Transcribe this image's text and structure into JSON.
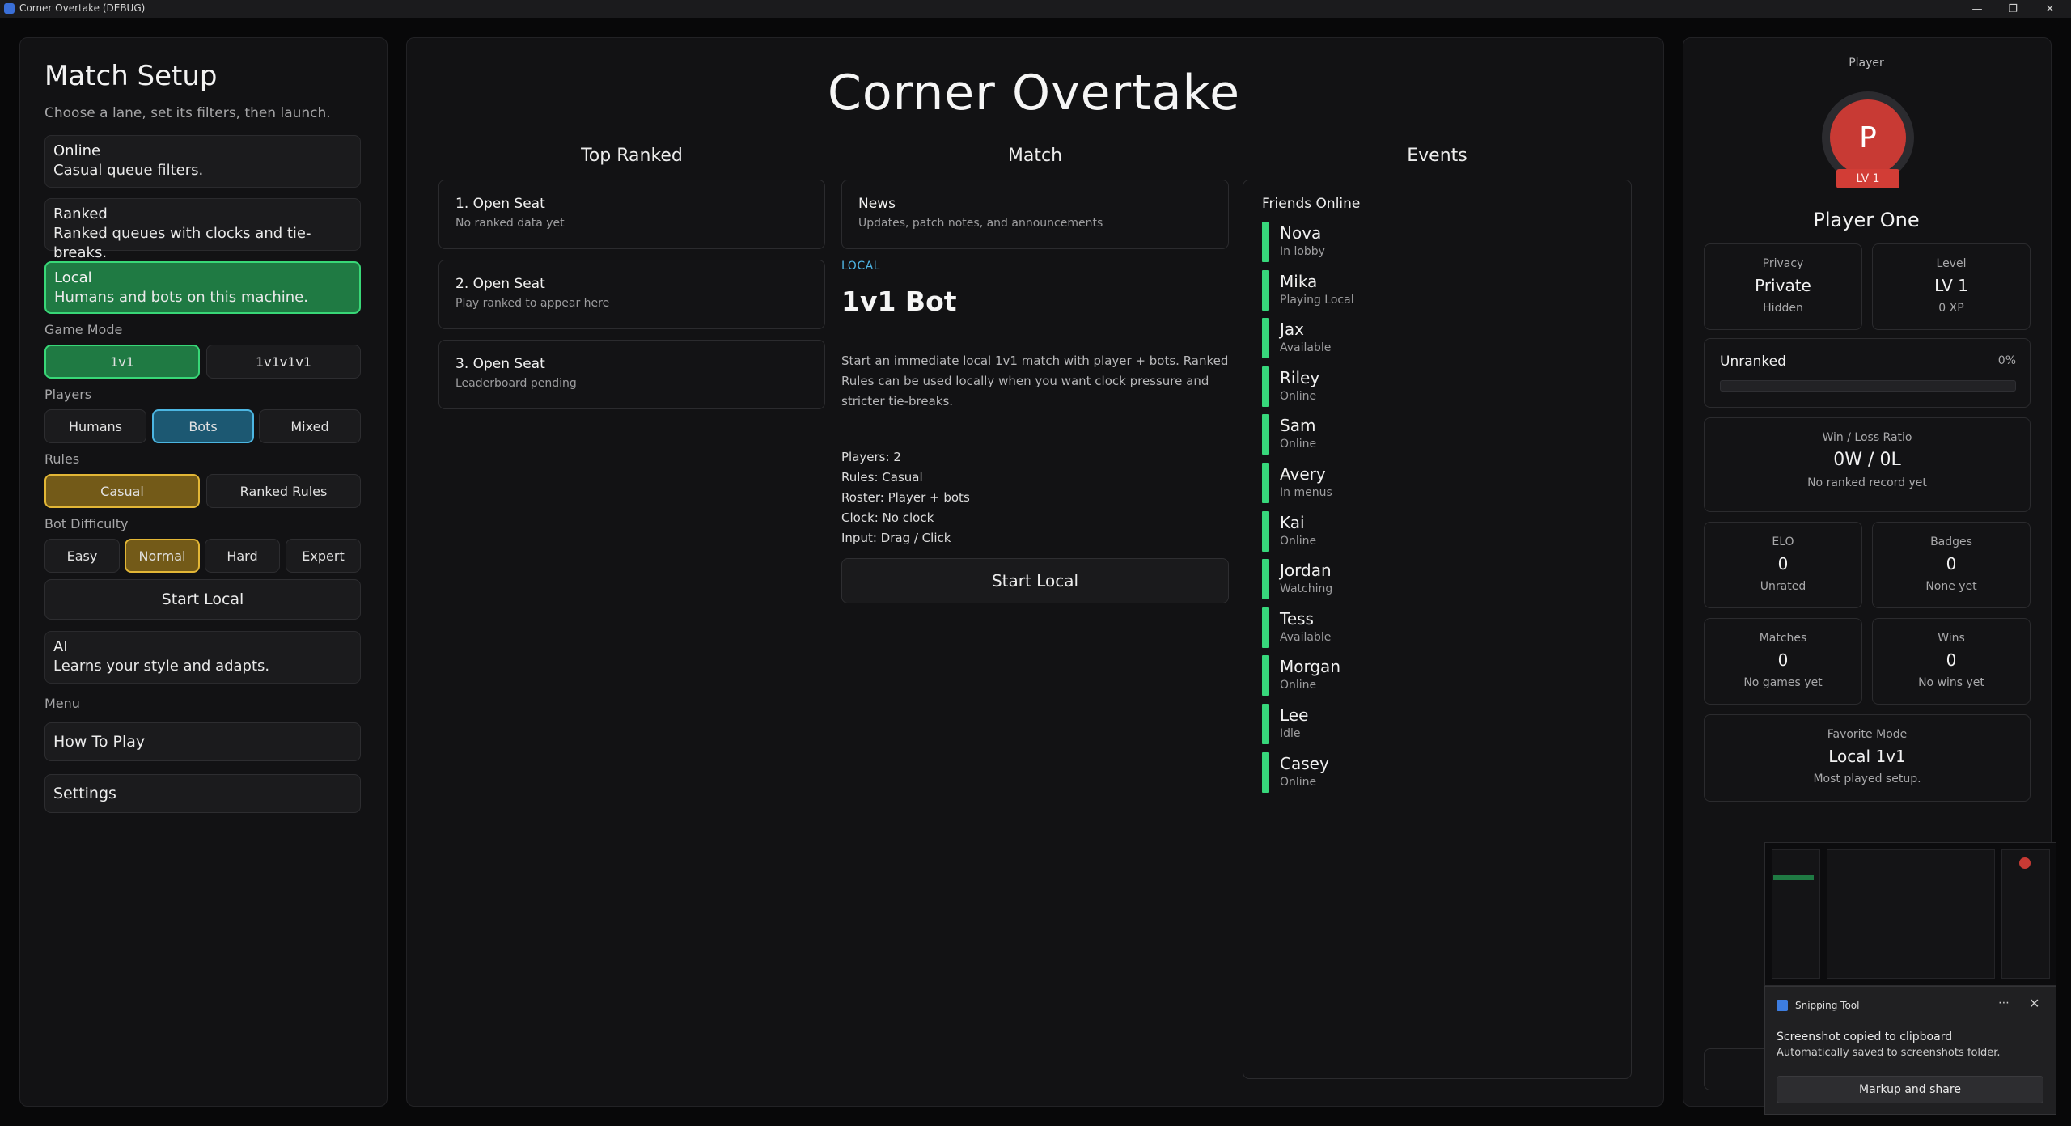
{
  "window": {
    "title": "Corner Overtake (DEBUG)"
  },
  "setup": {
    "title": "Match Setup",
    "subtitle": "Choose a lane, set its filters, then launch.",
    "lanes": [
      {
        "title": "Online",
        "desc": "Casual queue filters."
      },
      {
        "title": "Ranked",
        "desc": "Ranked queues with clocks and tie-breaks."
      },
      {
        "title": "Local",
        "desc": "Humans and bots on this machine."
      }
    ],
    "game_mode": {
      "label": "Game Mode",
      "options": [
        "1v1",
        "1v1v1v1"
      ],
      "selected": "1v1"
    },
    "players": {
      "label": "Players",
      "options": [
        "Humans",
        "Bots",
        "Mixed"
      ],
      "selected": "Bots"
    },
    "rules": {
      "label": "Rules",
      "options": [
        "Casual",
        "Ranked Rules"
      ],
      "selected": "Casual"
    },
    "bot_difficulty": {
      "label": "Bot Difficulty",
      "options": [
        "Easy",
        "Normal",
        "Hard",
        "Expert"
      ],
      "selected": "Normal"
    },
    "start_button": "Start Local",
    "ai_lane": {
      "title": "AI",
      "desc": "Learns your style and adapts."
    },
    "menu": {
      "label": "Menu",
      "items": [
        "How To Play",
        "Settings"
      ]
    }
  },
  "main": {
    "title": "Corner Overtake",
    "columns": {
      "top_ranked": "Top Ranked",
      "match": "Match",
      "events": "Events"
    },
    "ranked_cards": [
      {
        "title": "1. Open Seat",
        "sub": "No ranked data yet"
      },
      {
        "title": "2. Open Seat",
        "sub": "Play ranked to appear here"
      },
      {
        "title": "3. Open Seat",
        "sub": "Leaderboard pending"
      }
    ],
    "news": {
      "title": "News",
      "sub": "Updates, patch notes, and announcements"
    },
    "match": {
      "tag": "LOCAL",
      "title": "1v1 Bot",
      "description": "Start an immediate local 1v1 match with player + bots. Ranked Rules can be used locally when you want clock pressure and stricter tie-breaks.",
      "details": [
        "Players: 2",
        "Rules: Casual",
        "Roster: Player + bots",
        "Clock: No clock",
        "Input: Drag / Click"
      ],
      "start_button": "Start Local"
    },
    "friends": {
      "heading": "Friends Online",
      "list": [
        {
          "name": "Nova",
          "status": "In lobby"
        },
        {
          "name": "Mika",
          "status": "Playing Local"
        },
        {
          "name": "Jax",
          "status": "Available"
        },
        {
          "name": "Riley",
          "status": "Online"
        },
        {
          "name": "Sam",
          "status": "Online"
        },
        {
          "name": "Avery",
          "status": "In menus"
        },
        {
          "name": "Kai",
          "status": "Online"
        },
        {
          "name": "Jordan",
          "status": "Watching"
        },
        {
          "name": "Tess",
          "status": "Available"
        },
        {
          "name": "Morgan",
          "status": "Online"
        },
        {
          "name": "Lee",
          "status": "Idle"
        },
        {
          "name": "Casey",
          "status": "Online"
        }
      ]
    }
  },
  "player": {
    "label": "Player",
    "avatar_letter": "P",
    "level_badge": "LV 1",
    "name": "Player One",
    "privacy": {
      "label": "Privacy",
      "value": "Private",
      "sub": "Hidden"
    },
    "level": {
      "label": "Level",
      "value": "LV 1",
      "sub": "0 XP"
    },
    "rank": {
      "label": "Unranked",
      "percent_text": "0%",
      "progress": 0
    },
    "win_loss": {
      "label": "Win / Loss Ratio",
      "value": "0W / 0L",
      "sub": "No ranked record yet"
    },
    "elo": {
      "label": "ELO",
      "value": "0",
      "sub": "Unrated"
    },
    "badges": {
      "label": "Badges",
      "value": "0",
      "sub": "None yet"
    },
    "matches": {
      "label": "Matches",
      "value": "0",
      "sub": "No games yet"
    },
    "wins": {
      "label": "Wins",
      "value": "0",
      "sub": "No wins yet"
    },
    "favorite": {
      "label": "Favorite Mode",
      "value": "Local 1v1",
      "sub": "Most played setup."
    }
  },
  "toast": {
    "app": "Snipping Tool",
    "more_icon": "ellipsis-icon",
    "heading": "Screenshot copied to clipboard",
    "body": "Automatically saved to screenshots folder.",
    "button": "Markup and share"
  },
  "colors": {
    "accent_green": "#37d77b",
    "accent_blue": "#4cb6e2",
    "accent_gold": "#e2b636",
    "avatar_red": "#c83a34"
  }
}
